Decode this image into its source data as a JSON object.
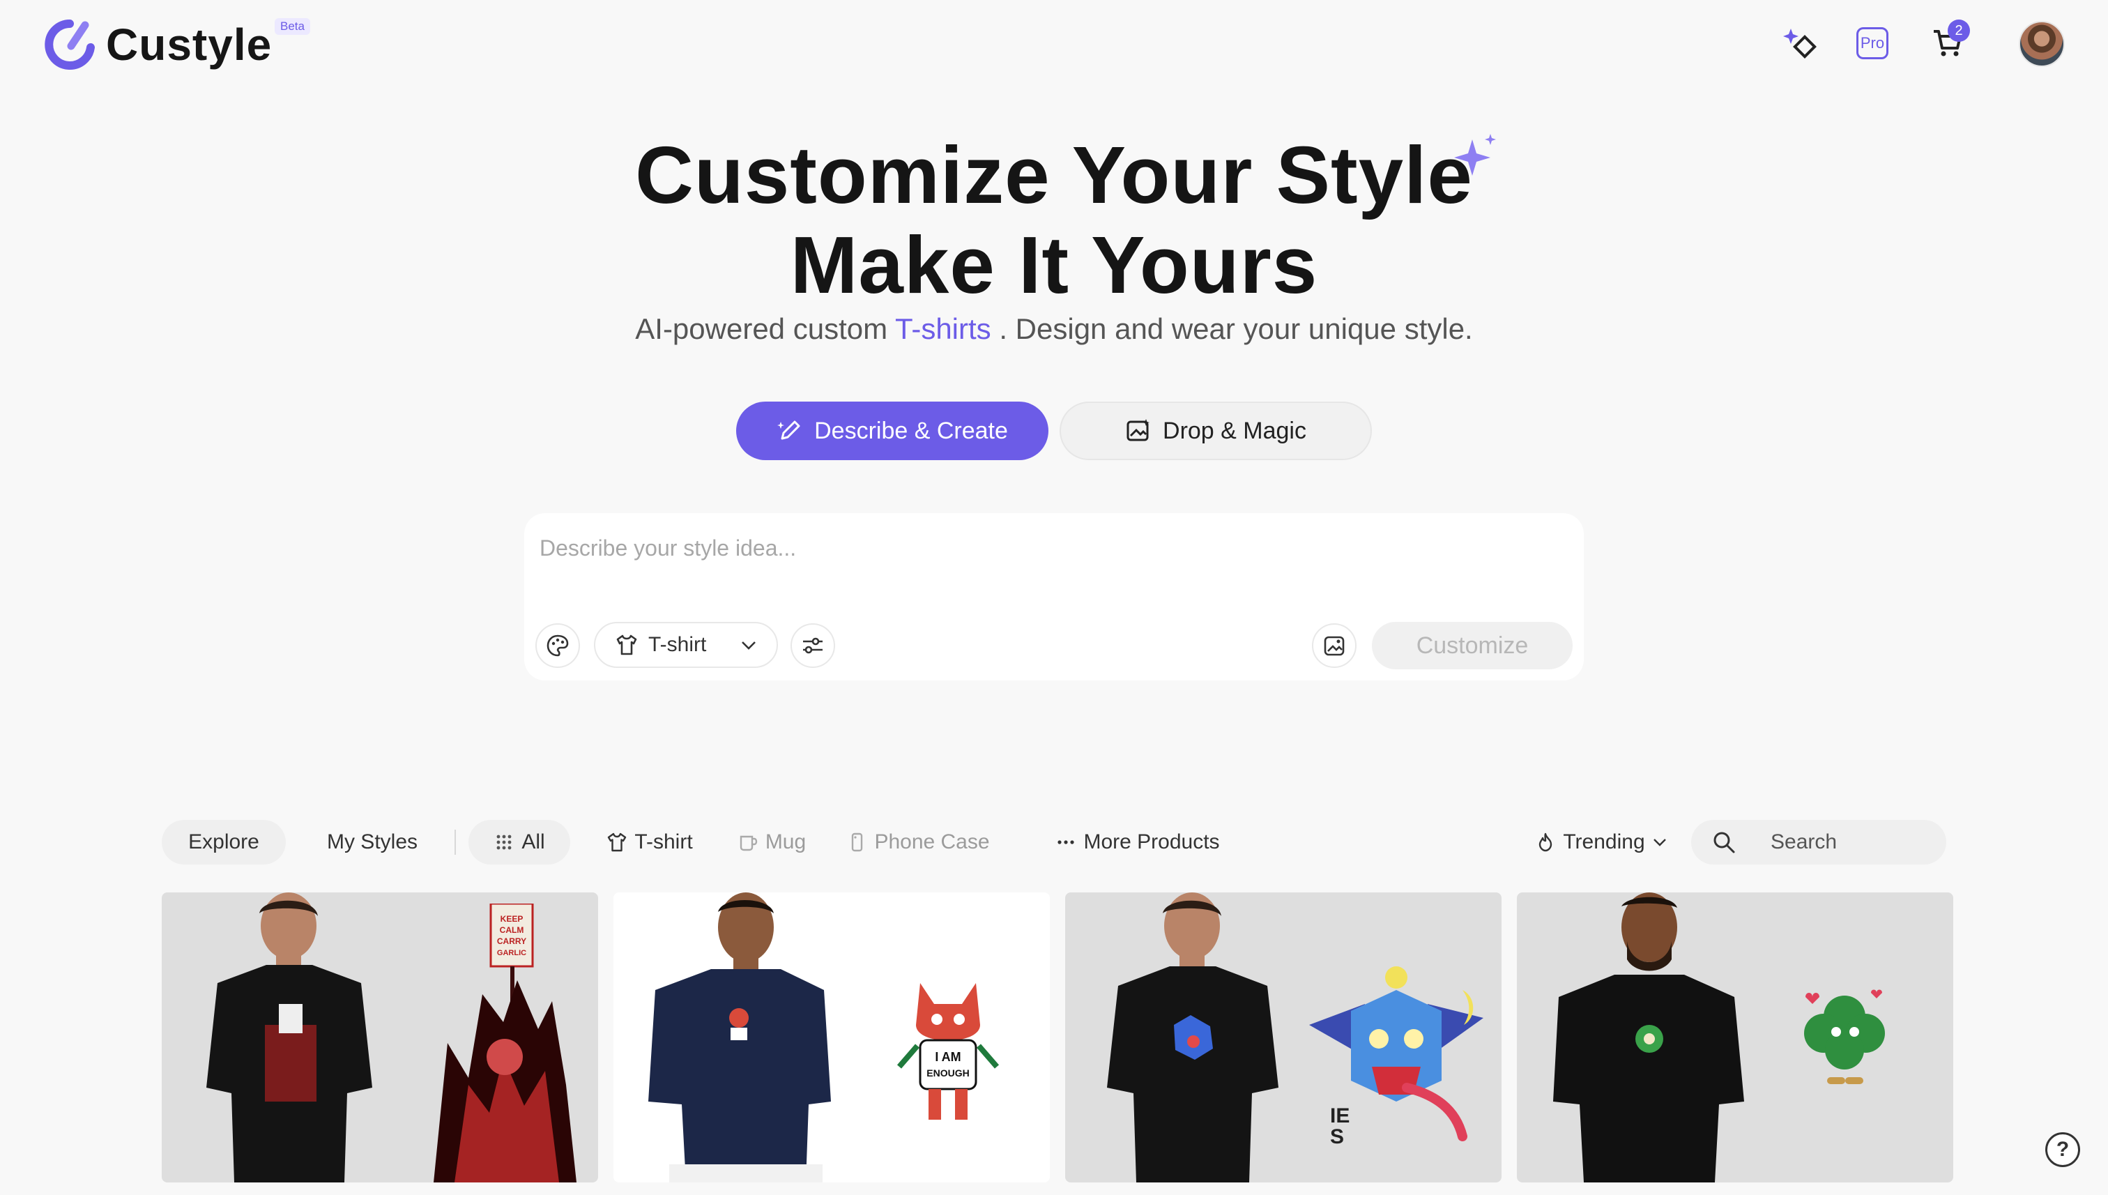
{
  "header": {
    "brand": "Custyle",
    "beta": "Beta",
    "pro": "Pro",
    "cart_count": "2",
    "icons": [
      "magic-sparkle-icon",
      "pro-icon",
      "cart-icon",
      "avatar"
    ]
  },
  "hero": {
    "title_line1": "Customize Your Style",
    "title_line2": "Make It Yours",
    "subtitle_pre": "AI-powered custom ",
    "subtitle_accent": "T-shirts",
    "subtitle_post": " . Design and wear your unique style."
  },
  "modes": {
    "describe": "Describe & Create",
    "drop": "Drop & Magic"
  },
  "prompt": {
    "placeholder": "Describe your style idea...",
    "product": "T-shirt",
    "customize": "Customize"
  },
  "explore": {
    "tabs": [
      "Explore",
      "My Styles"
    ],
    "filters": {
      "all": "All",
      "tshirt": "T-shirt",
      "mug": "Mug",
      "phone": "Phone Case",
      "more": "More Products"
    },
    "sort": "Trending",
    "search_placeholder": "Search"
  },
  "gallery": {
    "cards": [
      {
        "design": "KEEP CALM AND CARRY GARLIC",
        "shirt": "black"
      },
      {
        "design": "I AM ENOUGH",
        "shirt": "navy"
      },
      {
        "design": "bat monster",
        "shirt": "black"
      },
      {
        "design": "clover character",
        "shirt": "black"
      }
    ]
  },
  "colors": {
    "accent": "#6c5ce7",
    "background": "#f8f8f8"
  },
  "help": "?"
}
